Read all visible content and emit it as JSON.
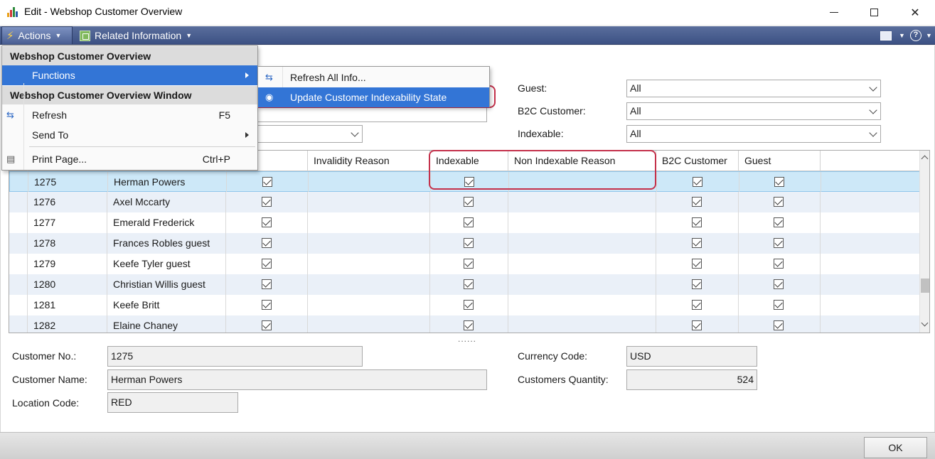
{
  "window": {
    "title": "Edit - Webshop Customer Overview",
    "minimize_label": "",
    "maximize_label": "",
    "close_label": "✕"
  },
  "ribbon": {
    "actions_label": "Actions",
    "related_label": "Related Information",
    "help_glyph": "?"
  },
  "menu": {
    "header1": "Webshop Customer Overview",
    "functions_label": "Functions",
    "header2": "Webshop Customer Overview Window",
    "refresh_label": "Refresh",
    "refresh_shortcut": "F5",
    "sendto_label": "Send To",
    "print_label": "Print Page...",
    "print_shortcut": "Ctrl+P"
  },
  "submenu": {
    "refresh_all_label": "Refresh All Info...",
    "update_label": "Update Customer Indexability State"
  },
  "filters": {
    "guest_label": "Guest:",
    "guest_value": "All",
    "b2c_label": "B2C Customer:",
    "b2c_value": "All",
    "indexable_label": "Indexable:",
    "indexable_value": "All"
  },
  "grid": {
    "columns": [
      "Invalidity Reason",
      "Indexable",
      "Non Indexable Reason",
      "B2C Customer",
      "Guest"
    ],
    "rows": [
      {
        "no": "1275",
        "name": "Herman Powers"
      },
      {
        "no": "1276",
        "name": "Axel Mccarty"
      },
      {
        "no": "1277",
        "name": "Emerald Frederick"
      },
      {
        "no": "1278",
        "name": "Frances Robles guest"
      },
      {
        "no": "1279",
        "name": "Keefe Tyler guest"
      },
      {
        "no": "1280",
        "name": "Christian Willis guest"
      },
      {
        "no": "1281",
        "name": "Keefe Britt"
      },
      {
        "no": "1282",
        "name": "Elaine Chaney"
      }
    ],
    "splitter": "......"
  },
  "details": {
    "customer_no_label": "Customer No.:",
    "customer_no_value": "1275",
    "customer_name_label": "Customer Name:",
    "customer_name_value": "Herman Powers",
    "location_label": "Location Code:",
    "location_value": "RED",
    "currency_label": "Currency Code:",
    "currency_value": "USD",
    "quantity_label": "Customers Quantity:",
    "quantity_value": "524"
  },
  "footer": {
    "ok_label": "OK"
  }
}
